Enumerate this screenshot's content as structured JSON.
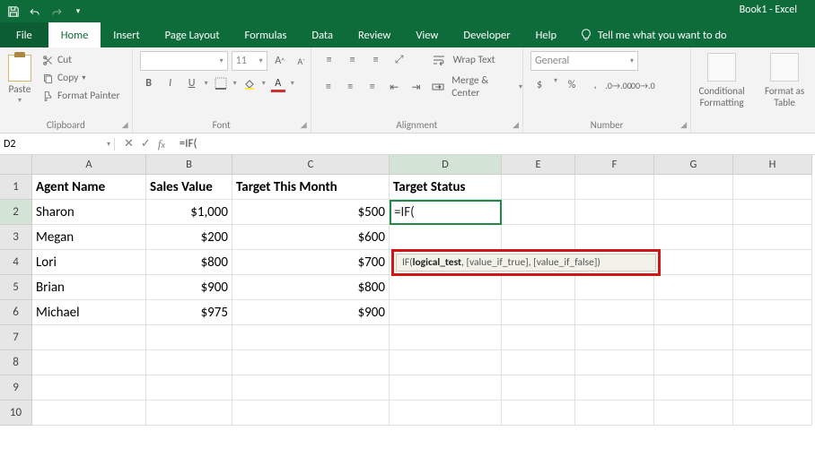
{
  "app": {
    "title": "Book1 - Excel"
  },
  "qat": {
    "save": "save-icon",
    "undo": "undo-icon",
    "redo": "redo-icon"
  },
  "tabs": {
    "file": "File",
    "home": "Home",
    "insert": "Insert",
    "pagelayout": "Page Layout",
    "formulas": "Formulas",
    "data": "Data",
    "review": "Review",
    "view": "View",
    "developer": "Developer",
    "help": "Help",
    "tellme": "Tell me what you want to do"
  },
  "ribbon": {
    "clipboard": {
      "paste": "Paste",
      "cut": "Cut",
      "copy": "Copy",
      "fmtpainter": "Format Painter",
      "label": "Clipboard"
    },
    "font": {
      "name_placeholder": "",
      "size": "11",
      "grow": "A",
      "shrink": "A",
      "bold": "B",
      "italic": "I",
      "underline": "U",
      "label": "Font"
    },
    "alignment": {
      "wrap": "Wrap Text",
      "merge": "Merge & Center",
      "label": "Alignment"
    },
    "number": {
      "format": "General",
      "currency": "$",
      "percent": "%",
      "comma": ",",
      "label": "Number"
    },
    "styles": {
      "cond": "Conditional Formatting",
      "table": "Format as Table"
    }
  },
  "formula_bar": {
    "name_box": "D2",
    "formula": "=IF("
  },
  "columns": [
    "A",
    "B",
    "C",
    "D",
    "E",
    "F",
    "G",
    "H"
  ],
  "headers": {
    "A": "Agent Name",
    "B": "Sales Value",
    "C": "Target This Month",
    "D": "Target Status"
  },
  "rows": [
    {
      "n": 1
    },
    {
      "n": 2,
      "A": "Sharon",
      "B": "$1,000",
      "C": "$500",
      "D": "=IF("
    },
    {
      "n": 3,
      "A": "Megan",
      "B": "$200",
      "C": "$600"
    },
    {
      "n": 4,
      "A": "Lori",
      "B": "$800",
      "C": "$700"
    },
    {
      "n": 5,
      "A": "Brian",
      "B": "$900",
      "C": "$800"
    },
    {
      "n": 6,
      "A": "Michael",
      "B": "$975",
      "C": "$900"
    },
    {
      "n": 7
    },
    {
      "n": 8
    },
    {
      "n": 9
    },
    {
      "n": 10
    }
  ],
  "tooltip": {
    "fn": "IF(",
    "arg1": "logical_test",
    "rest": ", [value_if_true], [value_if_false])"
  },
  "active": {
    "col": "D",
    "row": 2
  }
}
